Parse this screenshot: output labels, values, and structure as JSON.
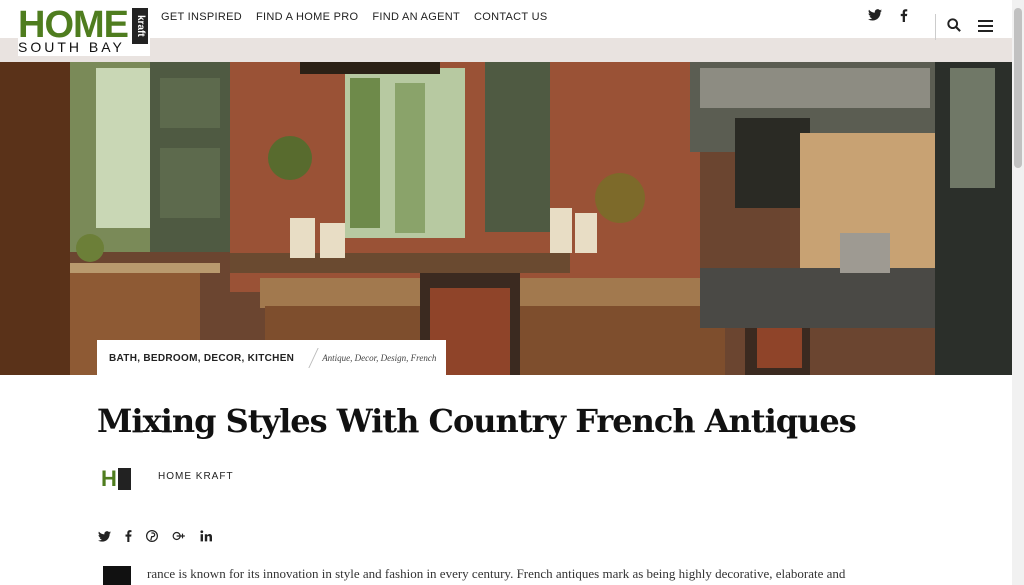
{
  "logo": {
    "main": "HOME",
    "badge": "kraft",
    "sub": "SOUTH BAY"
  },
  "nav": {
    "items": [
      "GET INSPIRED",
      "FIND A HOME PRO",
      "FIND AN AGENT",
      "CONTACT US"
    ]
  },
  "social_top": {
    "twitter": "twitter-icon",
    "facebook": "facebook-icon"
  },
  "hero": {
    "image": "kitchen-photo"
  },
  "post": {
    "categories": "BATH, BEDROOM, DECOR, KITCHEN",
    "tags": "Antique, Decor, Design, French",
    "title": "Mixing Styles With Country French Antiques",
    "author": "HOME KRAFT",
    "dropcap": "F",
    "excerpt": "rance is known for its innovation in style and fashion in every century. French antiques mark as being highly decorative, elaborate and"
  },
  "colors": {
    "brand_green": "#4f7d1f",
    "text": "#222222"
  }
}
